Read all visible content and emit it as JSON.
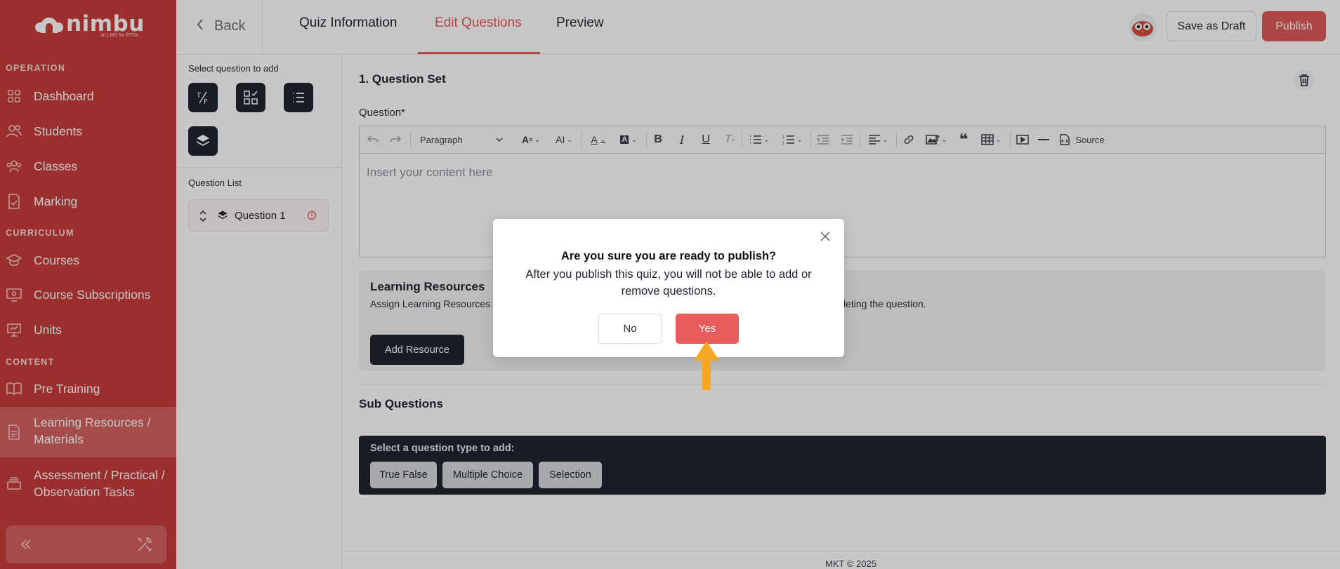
{
  "brand": {
    "name": "nimbu",
    "tagline": "an LMS for RTOs"
  },
  "sidebar": {
    "sections": [
      {
        "title": "OPERATION"
      },
      {
        "title": "CURRICULUM"
      },
      {
        "title": "CONTENT"
      }
    ],
    "items": [
      {
        "label": "Dashboard",
        "icon": "grid-icon"
      },
      {
        "label": "Students",
        "icon": "users-icon"
      },
      {
        "label": "Classes",
        "icon": "group-icon"
      },
      {
        "label": "Marking",
        "icon": "document-check-icon"
      },
      {
        "label": "Courses",
        "icon": "graduation-cap-icon"
      },
      {
        "label": "Course Subscriptions",
        "icon": "monitor-icon"
      },
      {
        "label": "Units",
        "icon": "presentation-icon"
      },
      {
        "label": "Pre Training",
        "icon": "book-open-icon"
      },
      {
        "label": "Learning Resources / Materials",
        "line1": "Learning Resources /",
        "line2": "Materials",
        "icon": "file-text-icon",
        "active": true
      },
      {
        "label": "Assessment / Practical / Observation Tasks",
        "line1": "Assessment / Practical /",
        "line2": "Observation Tasks",
        "icon": "layers-icon"
      }
    ]
  },
  "topbar": {
    "back_label": "Back",
    "tabs": [
      {
        "label": "Quiz Information"
      },
      {
        "label": "Edit Questions",
        "active": true
      },
      {
        "label": "Preview"
      }
    ],
    "save_draft_label": "Save as Draft",
    "publish_label": "Publish"
  },
  "question_panel": {
    "select_label": "Select question to add",
    "list_label": "Question List",
    "question_types": [
      "true-false-icon",
      "multiple-choice-icon",
      "selection-list-icon",
      "question-set-icon"
    ],
    "questions": [
      {
        "label": "Question 1",
        "status": "warning"
      }
    ]
  },
  "editor": {
    "section_title": "1. Question Set",
    "question_label": "Question*",
    "paragraph_style": "Paragraph",
    "source_label": "Source",
    "placeholder": "Insert your content here"
  },
  "learning_resources": {
    "title": "Learning Resources",
    "desc_left": "Assign Learning Resources",
    "desc_right": "leting the question.",
    "add_button": "Add Resource"
  },
  "sub_questions": {
    "title": "Sub Questions",
    "hint": "Select a question type to add:",
    "types": [
      "True False",
      "Multiple Choice",
      "Selection"
    ]
  },
  "footer": {
    "text": "MKT © 2025"
  },
  "modal": {
    "title": "Are you sure you are ready to publish?",
    "message": "After you publish this quiz, you will not be able to add or remove questions.",
    "no_label": "No",
    "yes_label": "Yes"
  },
  "colors": {
    "brand_red": "#c93b3b",
    "accent": "#e05a5a",
    "dark": "#1f2430",
    "arrow": "#f5a623"
  }
}
